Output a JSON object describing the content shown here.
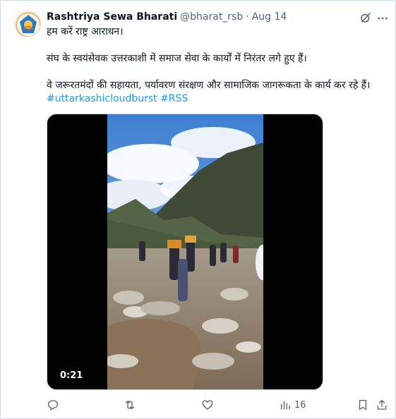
{
  "author": {
    "name": "Rashtriya Sewa Bharati",
    "handle": "@bharat_rsb",
    "separator": "·",
    "date": "Aug 14"
  },
  "tweet": {
    "line1": "हम करें राष्ट्र आराधन।",
    "line2": "संघ के स्वयंसेवक उत्तरकाशी में समाज सेवा के कार्यों में निरंतर लगे हुए हैं।",
    "line3": "वे जरूरतमंदों की सहायता, पर्यावरण संरक्षण और सामाजिक जागरूकता के कार्य कर रहे हैं।",
    "hashtags": [
      "#uttarkashicloudburst",
      "#RSS"
    ]
  },
  "media": {
    "duration": "0:21"
  },
  "actions": {
    "views_count": "16"
  },
  "icons": {
    "reply": "reply-icon",
    "retweet": "retweet-icon",
    "like": "heart-icon",
    "views": "views-icon",
    "bookmark": "bookmark-icon",
    "share": "share-icon",
    "grok": "grok-icon",
    "more": "more-icon"
  },
  "colors": {
    "link": "#1d9bf0",
    "muted": "#536471",
    "text": "#0f1419",
    "border": "#cfd9de"
  }
}
